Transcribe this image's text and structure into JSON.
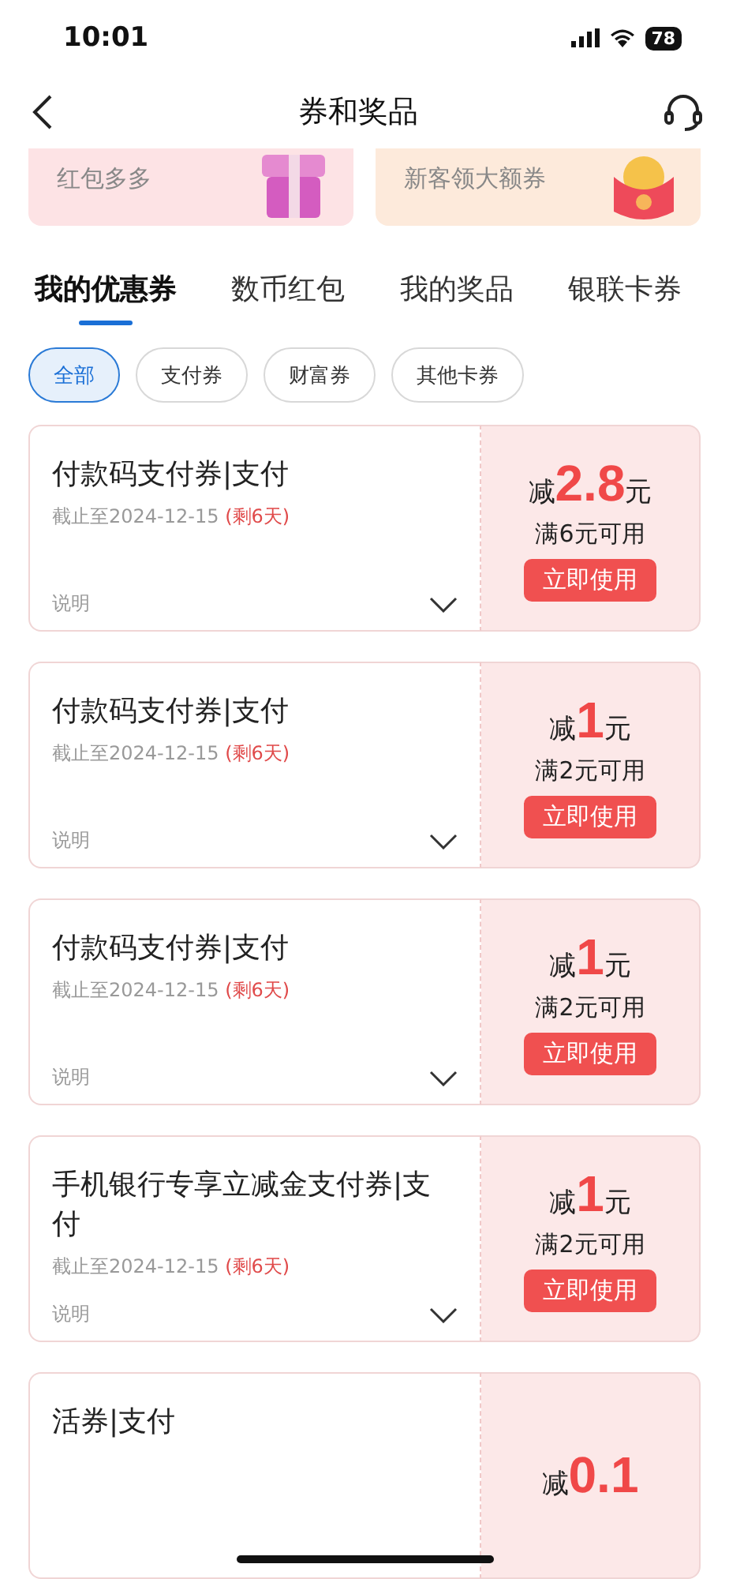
{
  "status_bar": {
    "time": "10:01",
    "battery": "78"
  },
  "header": {
    "title": "券和奖品"
  },
  "banners": [
    {
      "subtitle": "红包多多",
      "kind": "gift"
    },
    {
      "subtitle": "新客领大额券",
      "kind": "redpacket"
    }
  ],
  "tabs": [
    {
      "label": "我的优惠券",
      "selected": true
    },
    {
      "label": "数币红包",
      "selected": false
    },
    {
      "label": "我的奖品",
      "selected": false
    },
    {
      "label": "银联卡券",
      "selected": false
    }
  ],
  "filters": [
    {
      "label": "全部",
      "selected": true
    },
    {
      "label": "支付券",
      "selected": false
    },
    {
      "label": "财富券",
      "selected": false
    },
    {
      "label": "其他卡券",
      "selected": false
    }
  ],
  "coupons": [
    {
      "title": "付款码支付券|支付",
      "expiry": "截止至2024-12-15",
      "remaining": "(剩6天)",
      "note": "说明",
      "prefix": "减",
      "amount": "2.8",
      "unit": "元",
      "condition": "满6元可用",
      "action": "立即使用"
    },
    {
      "title": "付款码支付券|支付",
      "expiry": "截止至2024-12-15",
      "remaining": "(剩6天)",
      "note": "说明",
      "prefix": "减",
      "amount": "1",
      "unit": "元",
      "condition": "满2元可用",
      "action": "立即使用"
    },
    {
      "title": "付款码支付券|支付",
      "expiry": "截止至2024-12-15",
      "remaining": "(剩6天)",
      "note": "说明",
      "prefix": "减",
      "amount": "1",
      "unit": "元",
      "condition": "满2元可用",
      "action": "立即使用"
    },
    {
      "title": "手机银行专享立减金支付券|支付",
      "expiry": "截止至2024-12-15",
      "remaining": "(剩6天)",
      "note": "说明",
      "prefix": "减",
      "amount": "1",
      "unit": "元",
      "condition": "满2元可用",
      "action": "立即使用"
    },
    {
      "title": "活券|支付",
      "prefix": "减",
      "amount": "0.1"
    }
  ]
}
